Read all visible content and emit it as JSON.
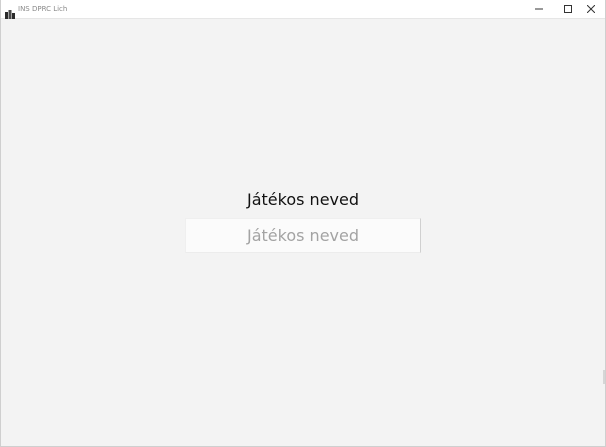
{
  "window": {
    "title": "INS DPRC Lich"
  },
  "icons": {
    "app": "app-icon",
    "minimize": "minimize-icon",
    "maximize": "maximize-icon",
    "close": "close-icon"
  },
  "form": {
    "label": "Játékos neved",
    "input_value": "",
    "input_placeholder": "Játékos neved"
  }
}
